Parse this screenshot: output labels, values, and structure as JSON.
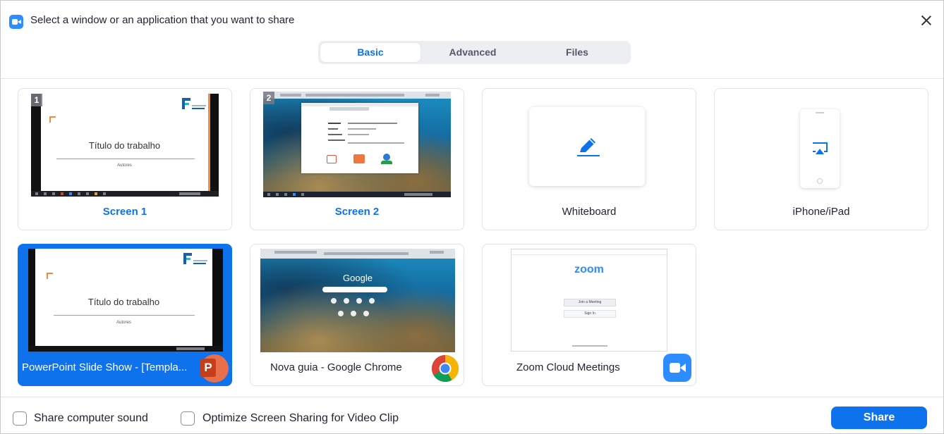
{
  "window": {
    "title": "Select a window or an application that you want to share"
  },
  "tabs": [
    {
      "label": "Basic",
      "active": true
    },
    {
      "label": "Advanced",
      "active": false
    },
    {
      "label": "Files",
      "active": false
    }
  ],
  "cards": {
    "screen1": {
      "label": "Screen 1",
      "badge": "1",
      "slide_title": "Título do trabalho",
      "slide_sub": "Autores"
    },
    "screen2": {
      "label": "Screen 2",
      "badge": "2"
    },
    "whiteboard": {
      "label": "Whiteboard"
    },
    "iphone": {
      "label": "iPhone/iPad"
    },
    "powerpoint": {
      "label": "PowerPoint Slide Show - [Templa...",
      "slide_title": "Título do trabalho",
      "slide_sub": "Autores",
      "selected": true
    },
    "chrome": {
      "label": "Nova guia - Google Chrome",
      "google_text": "Google"
    },
    "zoom": {
      "label": "Zoom Cloud Meetings",
      "logo_text": "zoom",
      "join_label": "Join a Meeting",
      "signin_label": "Sign In"
    }
  },
  "footer": {
    "share_sound_label": "Share computer sound",
    "optimize_label": "Optimize Screen Sharing for Video Clip",
    "share_button": "Share"
  },
  "colors": {
    "accent": "#0e72ed",
    "zoom_blue": "#2d8cff",
    "ppt_orange": "#d24726"
  }
}
